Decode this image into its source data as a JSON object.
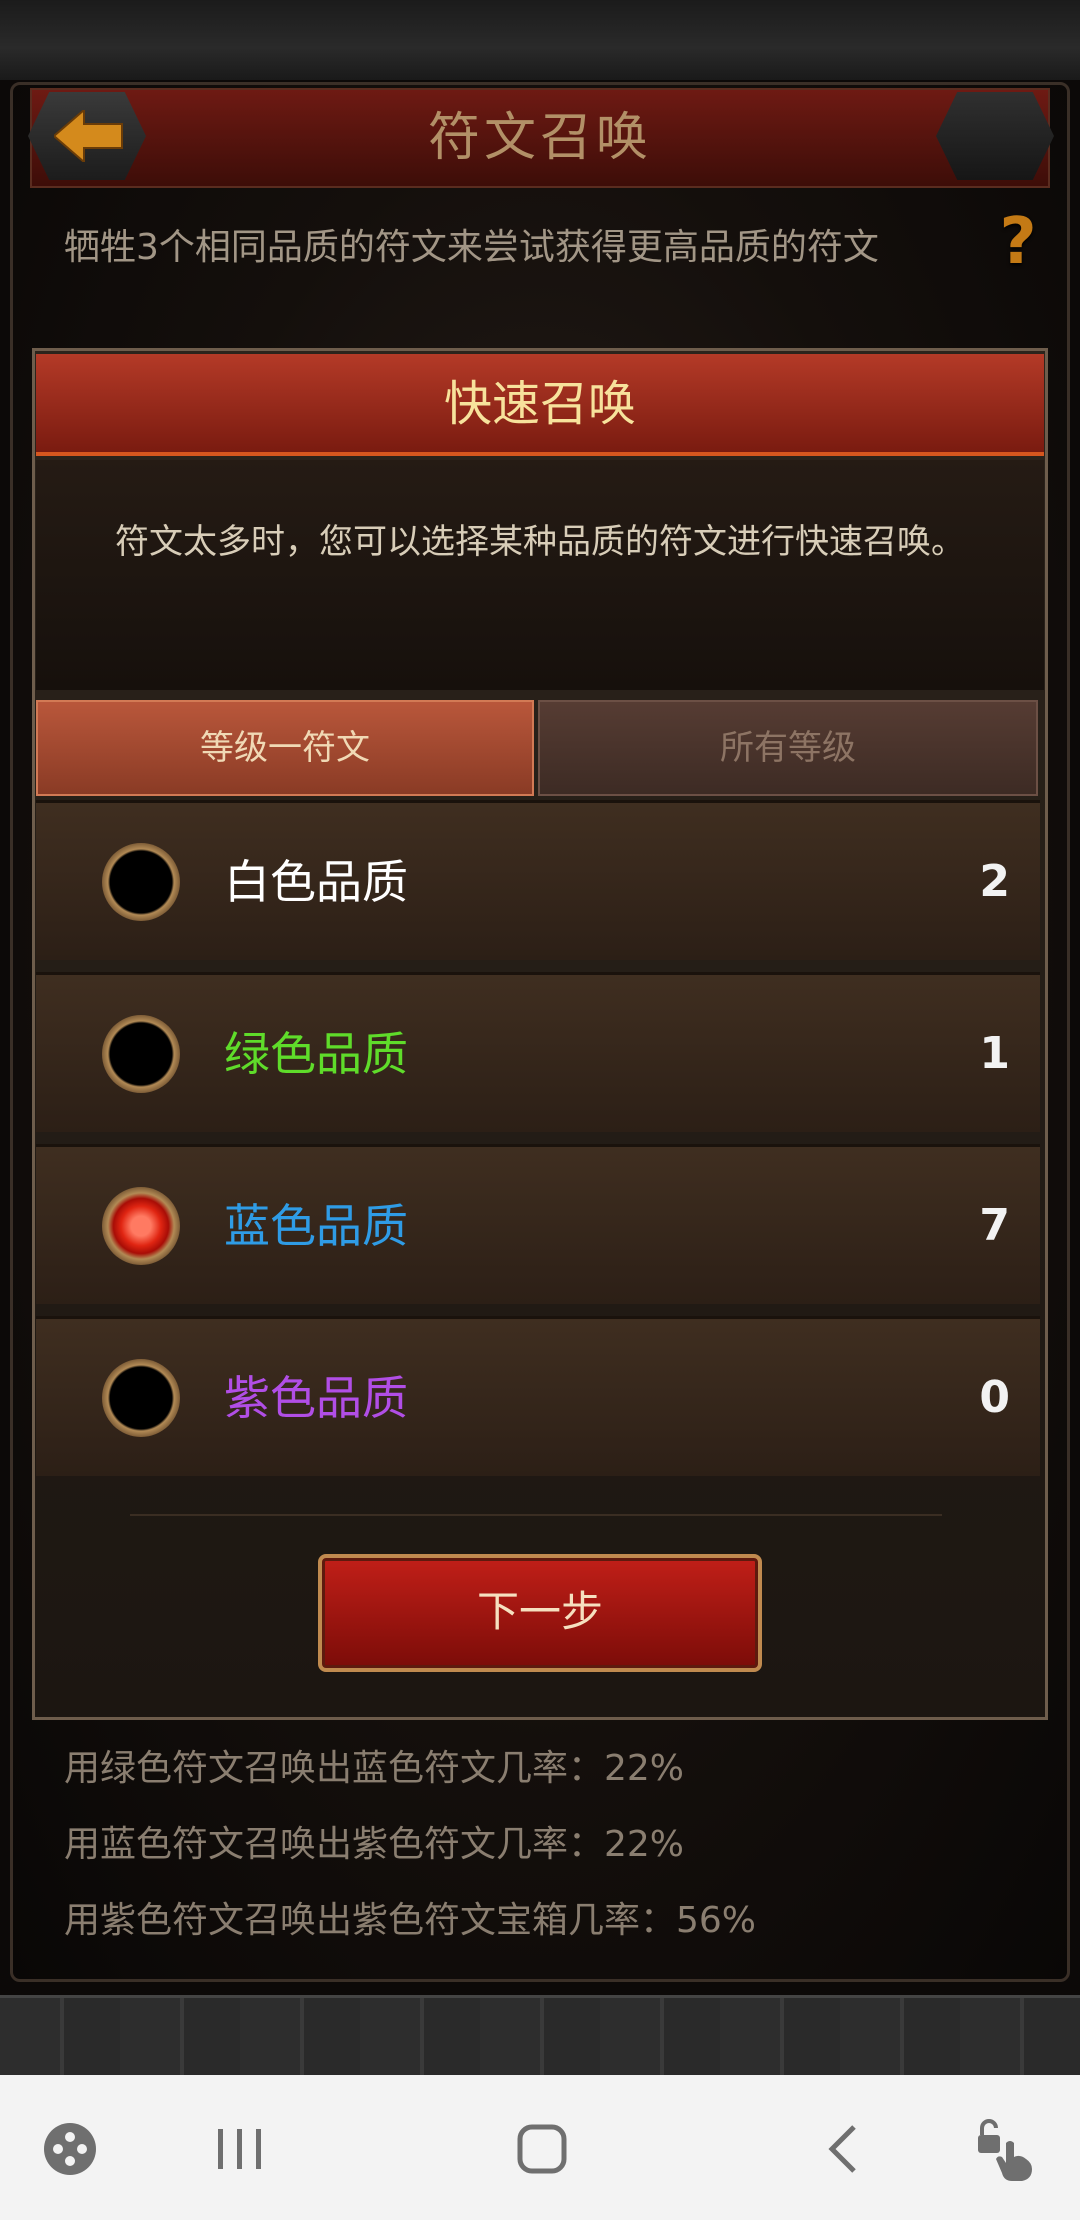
{
  "header": {
    "title": "符文召唤"
  },
  "subtitle": "牺牲3个相同品质的符文来尝试获得更高品质的符文",
  "help_label": "?",
  "dialog": {
    "title": "快速召唤",
    "description": "符文太多时，您可以选择某种品质的符文进行快速召唤。",
    "tabs": [
      {
        "label": "等级一符文",
        "selected": true
      },
      {
        "label": "所有等级",
        "selected": false
      }
    ],
    "qualities": [
      {
        "label": "白色品质",
        "count": "2",
        "color": "#ffffff",
        "selected": false
      },
      {
        "label": "绿色品质",
        "count": "1",
        "color": "#5fdc2a",
        "selected": false
      },
      {
        "label": "蓝色品质",
        "count": "7",
        "color": "#2f9ce6",
        "selected": true
      },
      {
        "label": "紫色品质",
        "count": "0",
        "color": "#b14ee6",
        "selected": false
      }
    ],
    "next_label": "下一步"
  },
  "odds": [
    "用绿色符文召唤出蓝色符文几率：22%",
    "用蓝色符文召唤出紫色符文几率：22%",
    "用紫色符文召唤出紫色符文宝箱几率：56%"
  ],
  "navbar": {
    "icons": [
      "game-launcher-icon",
      "recent-apps-icon",
      "home-icon",
      "back-icon",
      "touch-lock-icon"
    ]
  }
}
